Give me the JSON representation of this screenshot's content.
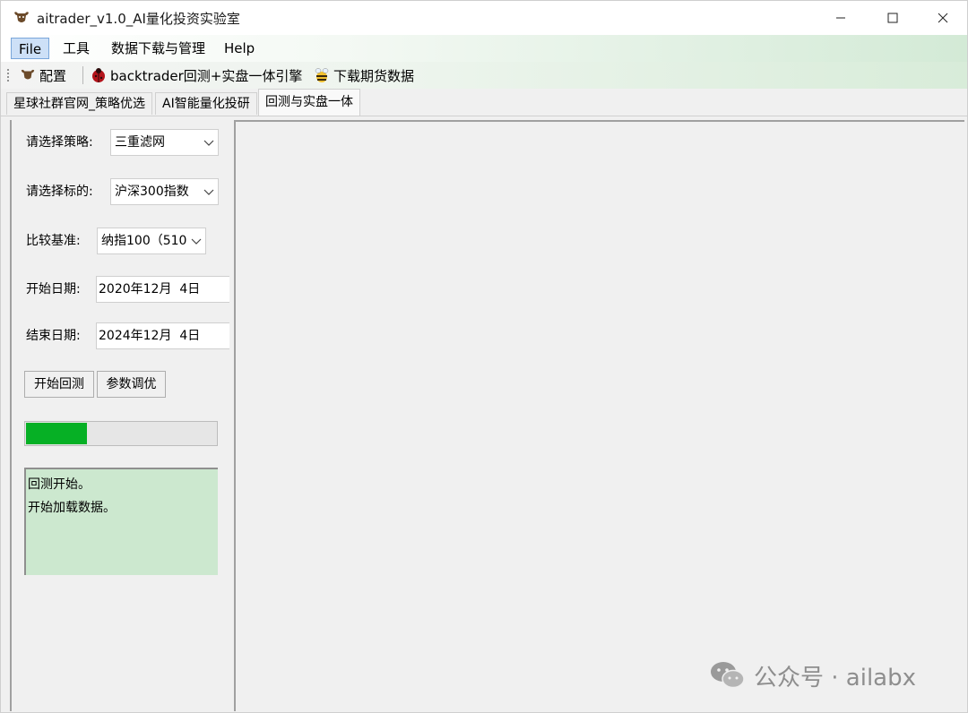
{
  "window": {
    "title": "aitrader_v1.0_AI量化投资实验室"
  },
  "menubar": {
    "items": [
      {
        "label": "File"
      },
      {
        "label": "工具"
      },
      {
        "label": "数据下载与管理"
      },
      {
        "label": "Help"
      }
    ]
  },
  "toolbar": {
    "items": [
      {
        "label": "配置",
        "icon": "buffalo-icon"
      },
      {
        "label": "backtrader回测+实盘一体引擎",
        "icon": "ladybug-icon"
      },
      {
        "label": "下载期货数据",
        "icon": "bee-icon"
      }
    ]
  },
  "tabs": [
    {
      "label": "星球社群官网_策略优选"
    },
    {
      "label": "AI智能量化投研"
    },
    {
      "label": "回测与实盘一体"
    }
  ],
  "form": {
    "strategy_label": "请选择策略:",
    "strategy_value": "三重滤网",
    "target_label": "请选择标的:",
    "target_value": "沪深300指数",
    "benchmark_label": "比较基准:",
    "benchmark_value": "纳指100（510",
    "start_label": "开始日期:",
    "start_value": "2020年12月  4日",
    "end_label": "结束日期:",
    "end_value": "2024年12月  4日",
    "start_backtest_button": "开始回测",
    "param_tune_button": "参数调优"
  },
  "progress": {
    "fraction": 0.32,
    "color": "#06b025"
  },
  "log": {
    "lines": [
      "回测开始。",
      "开始加载数据。"
    ],
    "background": "#cce8cf"
  },
  "watermark": {
    "text": "公众号 · ailabx"
  }
}
